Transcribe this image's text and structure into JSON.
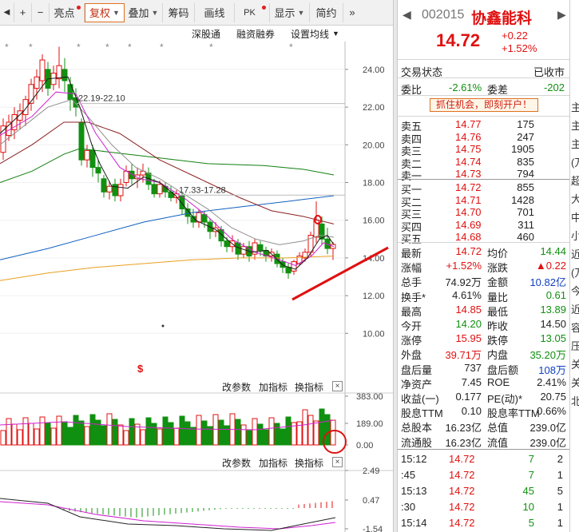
{
  "toolbar": {
    "items": [
      "亮点",
      "复权",
      "叠加",
      "筹码",
      "画线",
      "PK",
      "显示",
      "简约"
    ],
    "nav_left": "◀",
    "nav_zoom_in": "+",
    "nav_zoom_out": "−",
    "more": "»"
  },
  "subtoolbar": {
    "links": [
      "深股通",
      "融资融券",
      "设置均线"
    ]
  },
  "main_chart": {
    "y_ticks": [
      "24.00",
      "22.00",
      "20.00",
      "18.00",
      "16.00",
      "14.00",
      "12.00",
      "10.00"
    ],
    "annotation_1": "22.19-22.10",
    "annotation_2": "17.33-17.28",
    "marker": "$"
  },
  "volume_panel": {
    "links": [
      "改参数",
      "加指标",
      "换指标"
    ],
    "close": "×",
    "y_ticks": [
      "383.00",
      "189.00",
      "0.00"
    ]
  },
  "macd_panel": {
    "links": [
      "改参数",
      "加指标",
      "换指标"
    ],
    "close": "×",
    "y_ticks": [
      "2.49",
      "0.47",
      "-1.54"
    ]
  },
  "quote": {
    "code": "002015",
    "name": "协鑫能科",
    "price": "14.72",
    "change": "+0.22",
    "change_pct": "+1.52%",
    "status_label": "交易状态",
    "status_value": "已收市",
    "weibi_label": "委比",
    "weibi_value": "-2.61%",
    "weicha_label": "委差",
    "weicha_value": "-202",
    "promo": "抓住机会，即刻开户！",
    "asks": [
      {
        "label": "卖五",
        "price": "14.77",
        "vol": "175"
      },
      {
        "label": "卖四",
        "price": "14.76",
        "vol": "247"
      },
      {
        "label": "卖三",
        "price": "14.75",
        "vol": "1905"
      },
      {
        "label": "卖二",
        "price": "14.74",
        "vol": "835"
      },
      {
        "label": "卖一",
        "price": "14.73",
        "vol": "794"
      }
    ],
    "bids": [
      {
        "label": "买一",
        "price": "14.72",
        "vol": "855"
      },
      {
        "label": "买二",
        "price": "14.71",
        "vol": "1428"
      },
      {
        "label": "买三",
        "price": "14.70",
        "vol": "701"
      },
      {
        "label": "买四",
        "price": "14.69",
        "vol": "311"
      },
      {
        "label": "买五",
        "price": "14.68",
        "vol": "460"
      }
    ],
    "stats": [
      {
        "l1": "最新",
        "v1": "14.72",
        "c1": "red",
        "l2": "均价",
        "v2": "14.44",
        "c2": "green"
      },
      {
        "l1": "涨幅",
        "v1": "+1.52%",
        "c1": "red",
        "l2": "涨跌",
        "v2": "▲0.22",
        "c2": "red"
      },
      {
        "l1": "总手",
        "v1": "74.92万",
        "c1": "",
        "l2": "金额",
        "v2": "10.82亿",
        "c2": "blue"
      },
      {
        "l1": "换手*",
        "v1": "4.61%",
        "c1": "",
        "l2": "量比",
        "v2": "0.61",
        "c2": "green"
      },
      {
        "l1": "最高",
        "v1": "14.85",
        "c1": "red",
        "l2": "最低",
        "v2": "13.89",
        "c2": "green"
      },
      {
        "l1": "今开",
        "v1": "14.20",
        "c1": "green",
        "l2": "昨收",
        "v2": "14.50",
        "c2": ""
      },
      {
        "l1": "涨停",
        "v1": "15.95",
        "c1": "red",
        "l2": "跌停",
        "v2": "13.05",
        "c2": "green"
      },
      {
        "l1": "外盘",
        "v1": "39.71万",
        "c1": "red",
        "l2": "内盘",
        "v2": "35.20万",
        "c2": "green"
      },
      {
        "l1": "盘后量",
        "v1": "737",
        "c1": "",
        "l2": "盘后额",
        "v2": "108万",
        "c2": "blue"
      },
      {
        "l1": "净资产",
        "v1": "7.45",
        "c1": "",
        "l2": "ROE",
        "v2": "2.41%",
        "c2": ""
      },
      {
        "l1": "收益(一)",
        "v1": "0.177",
        "c1": "",
        "l2": "PE(动)*",
        "v2": "20.75",
        "c2": ""
      },
      {
        "l1": "股息TTM",
        "v1": "0.10",
        "c1": "",
        "l2": "股息率TTM",
        "v2": "0.66%",
        "c2": ""
      },
      {
        "l1": "总股本",
        "v1": "16.23亿",
        "c1": "",
        "l2": "总值",
        "v2": "239.0亿",
        "c2": ""
      },
      {
        "l1": "流通股",
        "v1": "16.23亿",
        "c1": "",
        "l2": "流值",
        "v2": "239.0亿",
        "c2": ""
      }
    ],
    "ticks": [
      {
        "time": "15:12",
        "price": "14.72",
        "vol": "7",
        "n": "2"
      },
      {
        "time": ":45",
        "price": "14.72",
        "vol": "7",
        "n": "1"
      },
      {
        "time": "15:13",
        "price": "14.72",
        "vol": "45",
        "n": "5"
      },
      {
        "time": ":30",
        "price": "14.72",
        "vol": "10",
        "n": "1"
      },
      {
        "time": "15:14",
        "price": "14.72",
        "vol": "5",
        "n": "1"
      }
    ]
  },
  "edge_chars": [
    "主",
    "主",
    "主",
    "(万",
    "超",
    "大",
    "中",
    "小",
    "近",
    "(万",
    "今",
    "近",
    "容",
    "压",
    "关",
    "关",
    "北"
  ],
  "colors": {
    "up": "#e01010",
    "down": "#109010",
    "ma5": "#1a1a1a",
    "ma10": "#d020d0",
    "ma20": "#8b2020",
    "ma60": "#108010",
    "ma120": "#1060c0",
    "ma250": "#e8a020"
  }
}
